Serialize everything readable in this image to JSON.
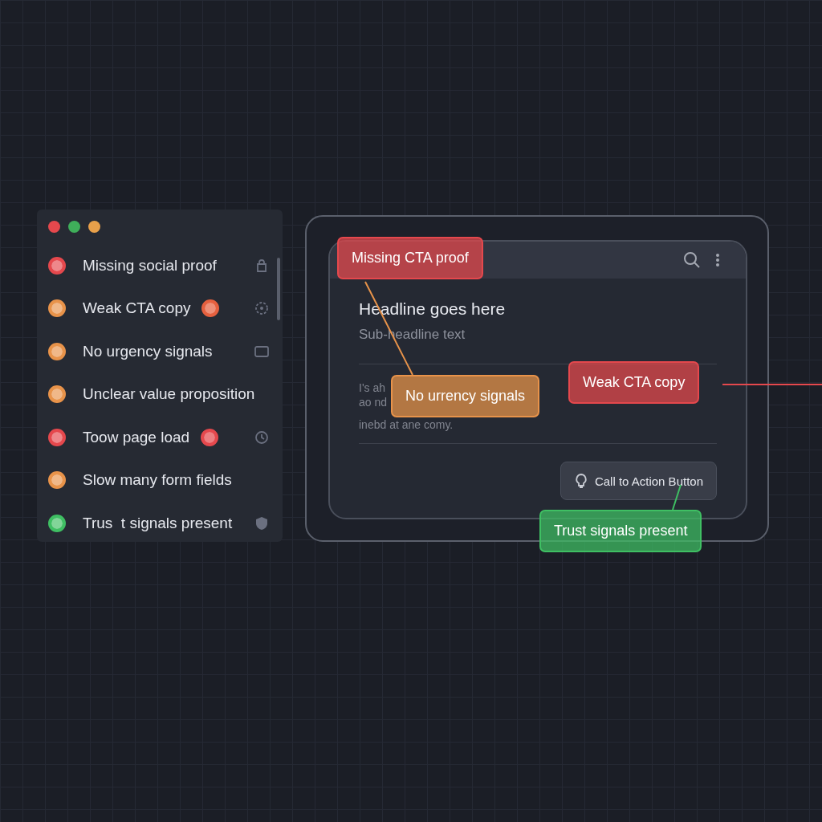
{
  "issues_panel": {
    "items": [
      {
        "label": "Missing social proof",
        "color": "#e5484d"
      },
      {
        "label": "Weak CTA copy",
        "color": "#e8934a",
        "badge": {
          "color": "#e5603f"
        }
      },
      {
        "label": "No urgency signals",
        "color": "#e8934a"
      },
      {
        "label": "Unclear value proposition",
        "color": "#e8934a"
      },
      {
        "label": "Toow page load",
        "color": "#e5484d",
        "badge": {
          "color": "#e5484d"
        }
      },
      {
        "label": "Slow many form fields",
        "color": "#e8934a"
      },
      {
        "label": "Trus  t signals present",
        "color": "#3fbf63"
      }
    ]
  },
  "mockup": {
    "headline": "Headline goes here",
    "subheadline": "Sub-headline text",
    "body_lines": [
      "I's ah",
      "ao nd",
      "inebd at ane comy."
    ],
    "cta_button": "Call to Action Button"
  },
  "annotations": [
    {
      "label": "Missing CTA proof",
      "color": "#e5484d"
    },
    {
      "label": "No urrency signals",
      "color": "#e8934a"
    },
    {
      "label": "Weak CTA copy",
      "color": "#e5484d"
    },
    {
      "label": "Trust signals present",
      "color": "#3fbf63"
    }
  ]
}
